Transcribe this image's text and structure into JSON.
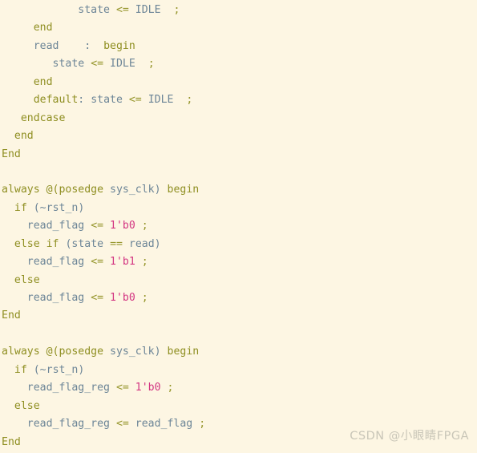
{
  "editor": {
    "background_color": "#fdf6e3",
    "language": "verilog",
    "colors": {
      "keyword": "#8f8f22",
      "identifier": "#6c8597",
      "operator": "#95952b",
      "number": "#d33682",
      "watermark": "#c9c6b8"
    },
    "lines": [
      {
        "id": "line-1",
        "indent": 12,
        "text": "state <= IDLE  ;"
      },
      {
        "id": "line-2",
        "indent": 5,
        "text": "end"
      },
      {
        "id": "line-3",
        "indent": 5,
        "text": "read    :  begin"
      },
      {
        "id": "line-4",
        "indent": 8,
        "text": "state <= IDLE  ;"
      },
      {
        "id": "line-5",
        "indent": 5,
        "text": "end"
      },
      {
        "id": "line-6",
        "indent": 5,
        "text": "default: state <= IDLE  ;"
      },
      {
        "id": "line-7",
        "indent": 3,
        "text": "endcase"
      },
      {
        "id": "line-8",
        "indent": 2,
        "text": "end"
      },
      {
        "id": "line-9",
        "indent": 0,
        "text": "End"
      },
      {
        "id": "line-10",
        "indent": 0,
        "text": ""
      },
      {
        "id": "line-11",
        "indent": 0,
        "text": "always @(posedge sys_clk) begin"
      },
      {
        "id": "line-12",
        "indent": 1,
        "text": "if (~rst_n)"
      },
      {
        "id": "line-13",
        "indent": 3,
        "text": "read_flag <= 1'b0 ;"
      },
      {
        "id": "line-14",
        "indent": 1,
        "text": "else if (state == read)"
      },
      {
        "id": "line-15",
        "indent": 3,
        "text": "read_flag <= 1'b1 ;"
      },
      {
        "id": "line-16",
        "indent": 1,
        "text": "else"
      },
      {
        "id": "line-17",
        "indent": 3,
        "text": "read_flag <= 1'b0 ;"
      },
      {
        "id": "line-18",
        "indent": 0,
        "text": "End"
      },
      {
        "id": "line-19",
        "indent": 0,
        "text": ""
      },
      {
        "id": "line-20",
        "indent": 0,
        "text": "always @(posedge sys_clk) begin"
      },
      {
        "id": "line-21",
        "indent": 1,
        "text": "if (~rst_n)"
      },
      {
        "id": "line-22",
        "indent": 3,
        "text": "read_flag_reg <= 1'b0 ;"
      },
      {
        "id": "line-23",
        "indent": 1,
        "text": "else"
      },
      {
        "id": "line-24",
        "indent": 3,
        "text": "read_flag_reg <= read_flag ;"
      },
      {
        "id": "line-25",
        "indent": 0,
        "text": "End"
      }
    ]
  },
  "watermark": {
    "text": "CSDN @小眼睛FPGA"
  }
}
